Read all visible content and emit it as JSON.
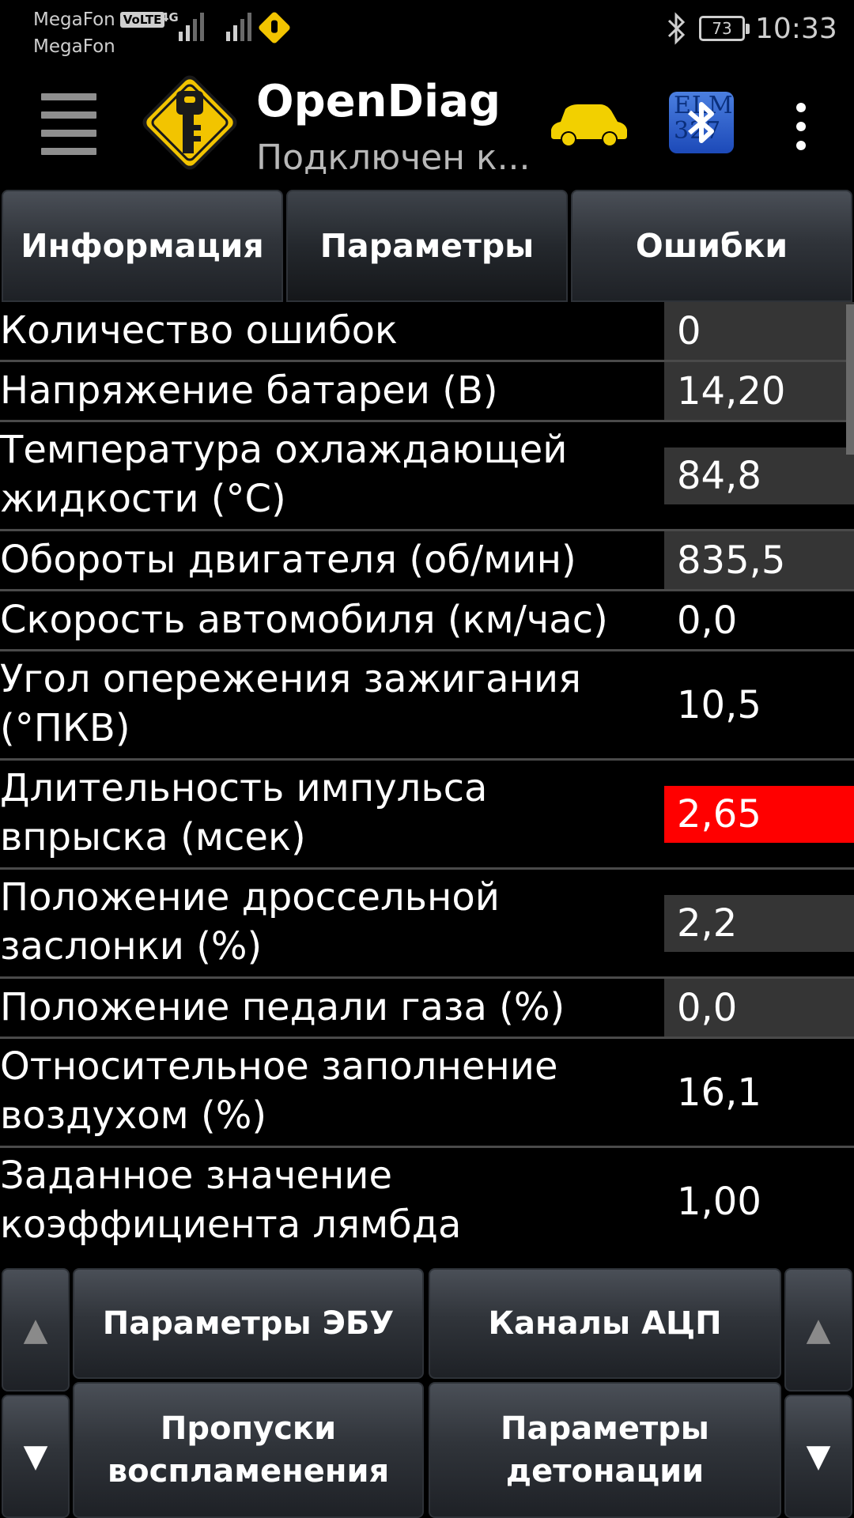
{
  "status": {
    "operator1": "MegaFon",
    "volte": "VoLTE",
    "network": "4G",
    "operator2": "MegaFon",
    "battery": "73",
    "time": "10:33"
  },
  "appbar": {
    "title": "OpenDiag",
    "subtitle": "Подключен к...",
    "bt_text": "ELM 327"
  },
  "tabs": [
    {
      "label": "Информация"
    },
    {
      "label": "Параметры"
    },
    {
      "label": "Ошибки"
    }
  ],
  "params": [
    {
      "label": "Количество ошибок",
      "value": "0"
    },
    {
      "label": "Напряжение батареи (В)",
      "value": "14,20"
    },
    {
      "label": "Температура охлаждающей",
      "label2": "жидкости (°C)",
      "value": "84,8"
    },
    {
      "label": "Обороты двигателя (об/мин)",
      "value": "835,5"
    },
    {
      "label": "Скорость автомобиля (км/час)",
      "value": "0,0"
    },
    {
      "label": "Угол опережения зажигания",
      "label2": "(°ПКВ)",
      "value": "10,5"
    },
    {
      "label": "Длительность импульса",
      "label2": "впрыска (мсек)",
      "value": "2,65"
    },
    {
      "label": "Положение дроссельной",
      "label2": "заслонки (%)",
      "value": "2,2"
    },
    {
      "label": "Положение педали газа (%)",
      "value": "0,0"
    },
    {
      "label": "Относительное заполнение",
      "label2": "воздухом (%)",
      "value": "16,1"
    },
    {
      "label": "Заданное значение",
      "label2": "коэффициента лямбда",
      "value": "1,00"
    }
  ],
  "bottom": {
    "up": "▲",
    "down": "▼",
    "ecu_params": "Параметры ЭБУ",
    "adc_channels": "Каналы АЦП",
    "misfires1": "Пропуски",
    "misfires2": "воспламенения",
    "knock1": "Параметры",
    "knock2": "детонации"
  },
  "colors": {
    "alert": "#ff0000",
    "value_bg": "#353535",
    "car": "#f2d000",
    "logo": "#f2c400"
  }
}
